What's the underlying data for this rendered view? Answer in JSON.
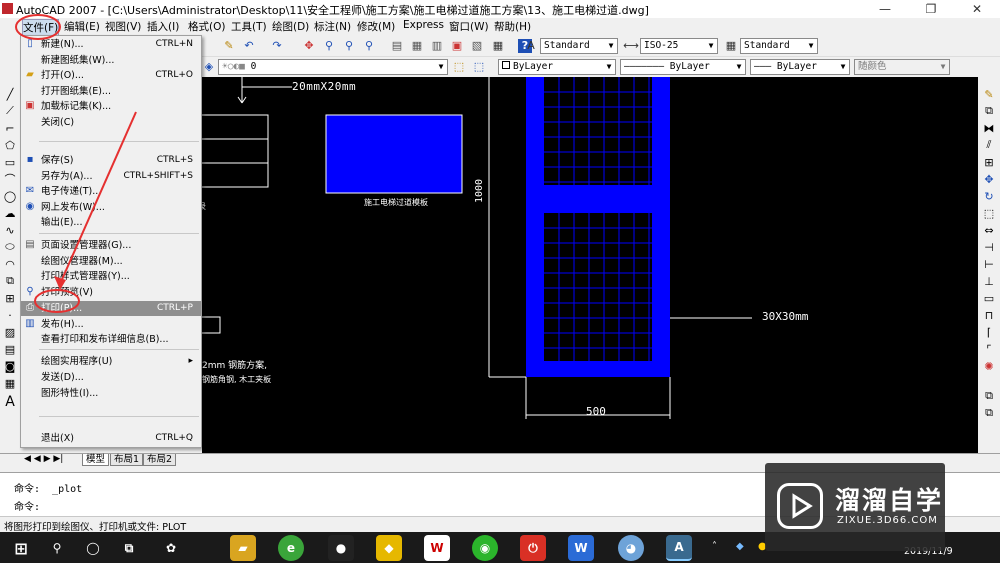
{
  "window": {
    "title": "AutoCAD 2007 - [C:\\Users\\Administrator\\Desktop\\11\\安全工程师\\施工方案\\施工电梯过道施工方案\\13、施工电梯过道.dwg]",
    "min_glyph": "—",
    "max_glyph": "❐",
    "close_glyph": "✕"
  },
  "menubar": {
    "items": [
      "文件(F)",
      "编辑(E)",
      "视图(V)",
      "插入(I)",
      "格式(O)",
      "工具(T)",
      "绘图(D)",
      "标注(N)",
      "修改(M)",
      "Express",
      "窗口(W)",
      "帮助(H)"
    ]
  },
  "toolbar": {
    "text_style": "Standard",
    "dim_style": "ISO-25",
    "table_style": "Standard",
    "layer": "0",
    "color": "ByLayer",
    "linetype": "ByLayer",
    "lineweight": "ByLayer",
    "plotstyle": "随颜色"
  },
  "file_menu": {
    "items": [
      {
        "label": "新建(N)...",
        "shortcut": "CTRL+N",
        "icon": "new-file-icon"
      },
      {
        "label": "新建图纸集(W)...",
        "shortcut": "",
        "icon": ""
      },
      {
        "label": "打开(O)...",
        "shortcut": "CTRL+O",
        "icon": "open-folder-icon"
      },
      {
        "label": "打开图纸集(E)...",
        "shortcut": "",
        "icon": ""
      },
      {
        "label": "加载标记集(K)...",
        "shortcut": "",
        "icon": "markup-icon"
      },
      {
        "label": "关闭(C)",
        "shortcut": "",
        "icon": ""
      },
      {
        "label": "保存(S)",
        "shortcut": "CTRL+S",
        "icon": "save-icon"
      },
      {
        "label": "另存为(A)...",
        "shortcut": "CTRL+SHIFT+S",
        "icon": ""
      },
      {
        "label": "电子传递(T)...",
        "shortcut": "",
        "icon": "etransmit-icon"
      },
      {
        "label": "网上发布(W)...",
        "shortcut": "",
        "icon": "web-publish-icon"
      },
      {
        "label": "输出(E)...",
        "shortcut": "",
        "icon": ""
      },
      {
        "label": "页面设置管理器(G)...",
        "shortcut": "",
        "icon": "page-setup-icon"
      },
      {
        "label": "绘图仪管理器(M)...",
        "shortcut": "",
        "icon": ""
      },
      {
        "label": "打印样式管理器(Y)...",
        "shortcut": "",
        "icon": ""
      },
      {
        "label": "打印预览(V)",
        "shortcut": "",
        "icon": "print-preview-icon"
      },
      {
        "label": "打印(P)...",
        "shortcut": "CTRL+P",
        "icon": "print-icon"
      },
      {
        "label": "发布(H)...",
        "shortcut": "",
        "icon": "publish-icon"
      },
      {
        "label": "查看打印和发布详细信息(B)...",
        "shortcut": "",
        "icon": ""
      },
      {
        "label": "绘图实用程序(U)",
        "shortcut": "▸",
        "icon": ""
      },
      {
        "label": "发送(D)...",
        "shortcut": "",
        "icon": ""
      },
      {
        "label": "图形特性(I)...",
        "shortcut": "",
        "icon": ""
      },
      {
        "label": "退出(X)",
        "shortcut": "CTRL+Q",
        "icon": ""
      }
    ]
  },
  "drawing": {
    "dim_20": "20mmX20mm",
    "label_board": "施工电梯过道模板",
    "dim_1000": "1000",
    "dim_30": "30X30mm",
    "dim_500": "500",
    "note_left": "2mm 钢筋方案,",
    "note_left2": "钢筋角钢, 木工夹板",
    "label_partial": "录"
  },
  "tabs": {
    "model": "模型",
    "layout1": "布局1",
    "layout2": "布局2",
    "nav": "◀ ◀ ▶ ▶|"
  },
  "command": {
    "line1": "命令:  _plot",
    "line2": "命令:"
  },
  "status": {
    "text": "将图形打印到绘图仪、打印机或文件:  PLOT"
  },
  "taskbar": {
    "date": "2019/11/9"
  },
  "watermark": {
    "brand": "溜溜自学",
    "url": "ZIXUE.3D66.COM"
  }
}
